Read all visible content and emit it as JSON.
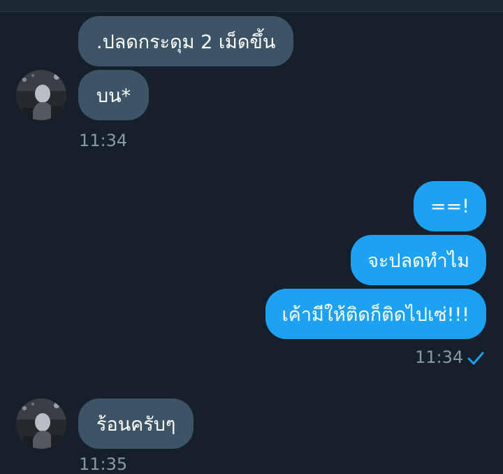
{
  "messages": {
    "incoming_1": {
      "text": ".ปลดกระดุม 2 เม็ดขึ้น"
    },
    "incoming_2": {
      "text": "บน*"
    },
    "incoming_time_1": "11:34",
    "outgoing_1": {
      "text": "==!"
    },
    "outgoing_2": {
      "text": "จะปลดทำไม"
    },
    "outgoing_3": {
      "text": "เค้ามีให้ติดก็ติดไปเซ่!!!"
    },
    "outgoing_time": "11:34",
    "incoming_3": {
      "text": "ร้อนครับๆ"
    },
    "incoming_time_2": "11:35"
  },
  "colors": {
    "background": "#15202b",
    "incoming_bubble": "#3d5466",
    "outgoing_bubble": "#1da1f2",
    "timestamp": "#8899a6",
    "read_check": "#1da1f2"
  },
  "icons": {
    "sent_status": "check-icon",
    "avatar": "user-avatar"
  }
}
